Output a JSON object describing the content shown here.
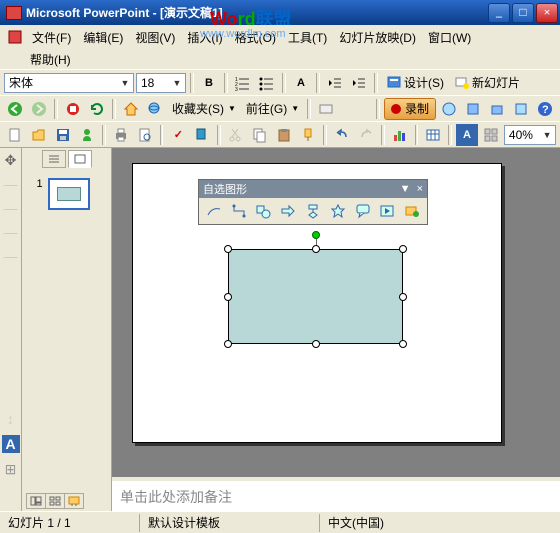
{
  "title": "Microsoft PowerPoint - [演示文稿1]",
  "watermark": {
    "p1": "Wo",
    "p2": "rd",
    "p3": "联盟",
    "url": "www.wordlm.com"
  },
  "menu": {
    "file": "文件(F)",
    "edit": "编辑(E)",
    "view": "视图(V)",
    "insert": "插入(I)",
    "format": "格式(O)",
    "tools": "工具(T)",
    "slideshow": "幻灯片放映(D)",
    "window": "窗口(W)",
    "help": "帮助(H)"
  },
  "format_toolbar": {
    "font": "宋体",
    "size": "18",
    "design": "设计(S)",
    "new_slide": "新幻灯片"
  },
  "web_toolbar": {
    "favorites": "收藏夹(S)",
    "goto": "前往(G)"
  },
  "record_btn": "录制",
  "zoom": "40%",
  "autoshape": {
    "title": "自选图形",
    "options_tip": "▼",
    "close": "×"
  },
  "thumb": {
    "num": "1"
  },
  "notes_placeholder": "单击此处添加备注",
  "status": {
    "slide": "幻灯片 1 / 1",
    "template": "默认设计模板",
    "lang": "中文(中国)"
  },
  "icons": {
    "home": "home",
    "refresh": "refresh",
    "stop": "stop",
    "search": "search",
    "new": "new",
    "open": "open",
    "save": "save",
    "print": "print"
  },
  "colors": {
    "shape_fill": "#b8d8d8"
  }
}
